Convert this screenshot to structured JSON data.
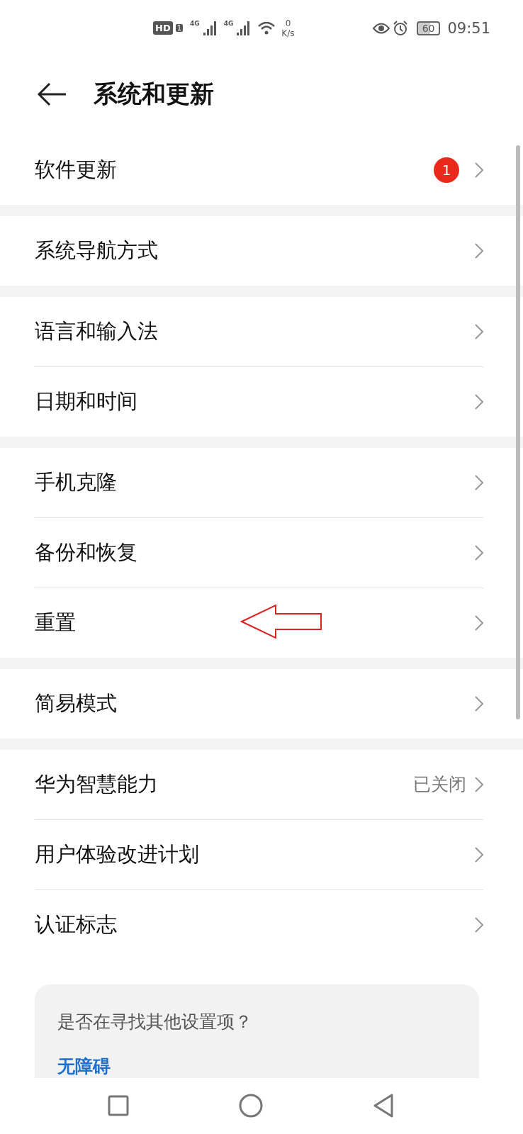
{
  "status_bar": {
    "hd": "HD",
    "sim": "1",
    "networks": [
      "4G",
      "4G"
    ],
    "speed_value": "0",
    "speed_unit": "K/s",
    "battery": "60",
    "time": "09:51"
  },
  "header": {
    "title": "系统和更新"
  },
  "groups": [
    {
      "items": [
        {
          "label": "软件更新",
          "badge": "1"
        }
      ]
    },
    {
      "items": [
        {
          "label": "系统导航方式"
        }
      ]
    },
    {
      "items": [
        {
          "label": "语言和输入法"
        },
        {
          "label": "日期和时间"
        }
      ]
    },
    {
      "items": [
        {
          "label": "手机克隆"
        },
        {
          "label": "备份和恢复"
        },
        {
          "label": "重置",
          "annotated": true
        }
      ]
    },
    {
      "items": [
        {
          "label": "简易模式"
        }
      ]
    },
    {
      "items": [
        {
          "label": "华为智慧能力",
          "value": "已关闭"
        },
        {
          "label": "用户体验改进计划"
        },
        {
          "label": "认证标志"
        }
      ]
    }
  ],
  "suggestion_card": {
    "question": "是否在寻找其他设置项？",
    "link": "无障碍"
  }
}
